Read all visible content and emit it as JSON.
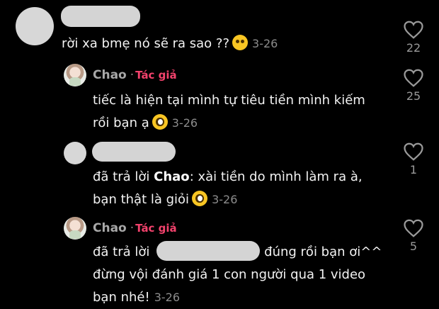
{
  "comments": [
    {
      "text": "rời xa bmẹ nó sẽ ra sao ??",
      "time": "3-26",
      "likes": "22",
      "emoji": "relieved-face"
    },
    {
      "author": "Chao",
      "author_badge": "Tác giả",
      "text_line1": "tiếc là hiện tại mình tự tiêu tiền mình kiếm",
      "text_line2": "rồi bạn ạ",
      "time": "3-26",
      "likes": "25",
      "emoji": "pleading-face"
    },
    {
      "reply_prefix": "đã trả lời",
      "reply_to": "Chao",
      "text_line1": "xài tiền do mình làm ra à,",
      "text_line2": "bạn thật là giỏi",
      "time": "3-26",
      "likes": "1",
      "emoji": "flushed-face"
    },
    {
      "author": "Chao",
      "author_badge": "Tác giả",
      "reply_prefix": "đã trả lời",
      "text_line1_suffix": "đúng rồi bạn ơi^^",
      "text_line2": "đừng vội đánh giá 1 con người qua 1 video",
      "text_line3": "bạn nhé!",
      "time": "3-26",
      "likes": "5"
    }
  ],
  "colors": {
    "background": "#000000",
    "author_badge": "#f2426c",
    "muted": "#8c8c8c"
  }
}
